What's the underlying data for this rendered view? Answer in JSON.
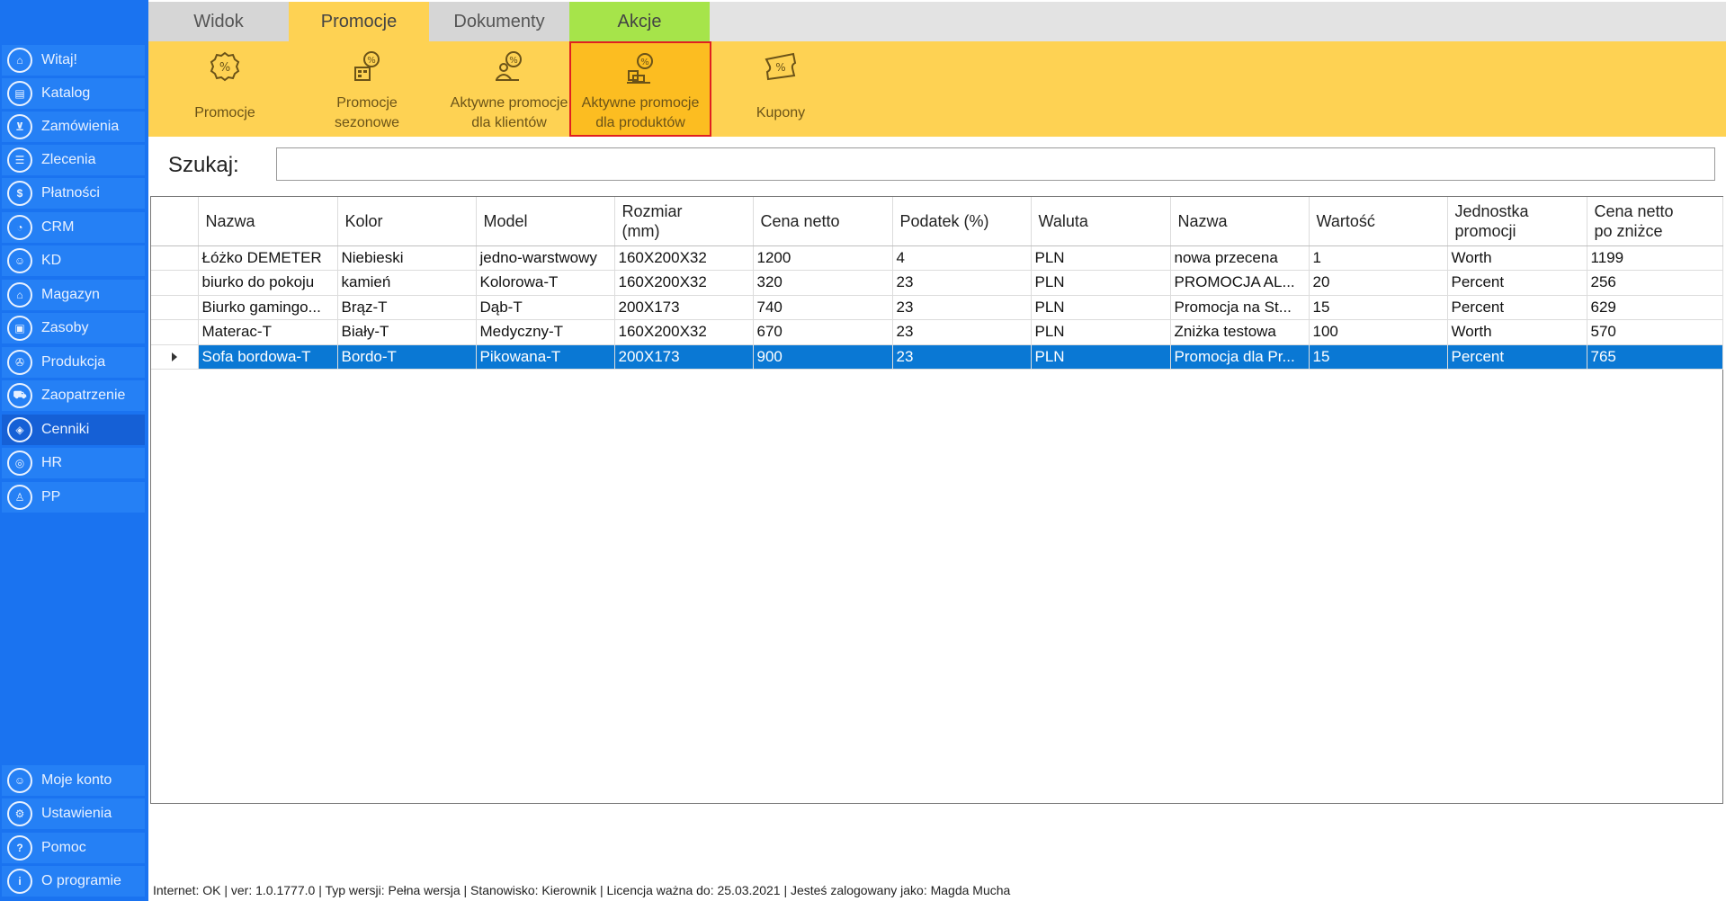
{
  "sidebar": {
    "items": [
      {
        "label": "Witaj!",
        "icon": "home-icon",
        "glyph": "⌂"
      },
      {
        "label": "Katalog",
        "icon": "book-icon",
        "glyph": "▤"
      },
      {
        "label": "Zamówienia",
        "icon": "cart-icon",
        "glyph": "⊻"
      },
      {
        "label": "Zlecenia",
        "icon": "list-icon",
        "glyph": "☰"
      },
      {
        "label": "Płatności",
        "icon": "dollar-icon",
        "glyph": "$"
      },
      {
        "label": "CRM",
        "icon": "crm-icon",
        "glyph": "◔"
      },
      {
        "label": "KD",
        "icon": "person-icon",
        "glyph": "☺"
      },
      {
        "label": "Magazyn",
        "icon": "warehouse-icon",
        "glyph": "⌂"
      },
      {
        "label": "Zasoby",
        "icon": "resources-icon",
        "glyph": "▣"
      },
      {
        "label": "Produkcja",
        "icon": "production-icon",
        "glyph": "✇"
      },
      {
        "label": "Zaopatrzenie",
        "icon": "truck-icon",
        "glyph": "⛟"
      },
      {
        "label": "Cenniki",
        "icon": "tag-icon",
        "glyph": "◈"
      },
      {
        "label": "HR",
        "icon": "hr-icon",
        "glyph": "◎"
      },
      {
        "label": "PP",
        "icon": "pp-icon",
        "glyph": "♙"
      }
    ],
    "bottom_items": [
      {
        "label": "Moje konto",
        "icon": "account-icon",
        "glyph": "☺"
      },
      {
        "label": "Ustawienia",
        "icon": "gear-icon",
        "glyph": "⚙"
      },
      {
        "label": "Pomoc",
        "icon": "help-icon",
        "glyph": "?"
      },
      {
        "label": "O programie",
        "icon": "info-icon",
        "glyph": "i"
      }
    ],
    "active_index": 11
  },
  "tabs": [
    {
      "label": "Widok"
    },
    {
      "label": "Promocje"
    },
    {
      "label": "Dokumenty"
    },
    {
      "label": "Akcje"
    }
  ],
  "ribbon": {
    "buttons": [
      {
        "line1": "Promocje",
        "line2": "",
        "icon": "percent-badge-icon"
      },
      {
        "line1": "Promocje",
        "line2": "sezonowe",
        "icon": "seasonal-promo-icon"
      },
      {
        "line1": "Aktywne promocje",
        "line2": "dla klientów",
        "icon": "client-promo-icon"
      },
      {
        "line1": "Aktywne promocje",
        "line2": "dla produktów",
        "icon": "product-promo-icon"
      },
      {
        "line1": "Kupony",
        "line2": "",
        "icon": "coupon-icon"
      }
    ]
  },
  "search": {
    "label": "Szukaj:",
    "value": ""
  },
  "grid": {
    "headers": [
      [
        "Nazwa"
      ],
      [
        "Kolor"
      ],
      [
        "Model"
      ],
      [
        "Rozmiar",
        "(mm)"
      ],
      [
        "Cena netto"
      ],
      [
        "Podatek (%)"
      ],
      [
        "Waluta"
      ],
      [
        "Nazwa"
      ],
      [
        "Wartość"
      ],
      [
        "Jednostka",
        "promocji"
      ],
      [
        "Cena netto",
        "po zniżce"
      ]
    ],
    "rows": [
      [
        "Łóżko DEMETER",
        "Niebieski",
        "jedno-warstwowy",
        "160X200X32",
        "1200",
        "4",
        "PLN",
        "nowa przecena",
        "1",
        "Worth",
        "1199"
      ],
      [
        "biurko do pokoju",
        "kamień",
        "Kolorowa-T",
        "160X200X32",
        "320",
        "23",
        "PLN",
        "PROMOCJA AL...",
        "20",
        "Percent",
        "256"
      ],
      [
        "Biurko gamingo...",
        "Brąz-T",
        "Dąb-T",
        "200X173",
        "740",
        "23",
        "PLN",
        "Promocja na St...",
        "15",
        "Percent",
        "629"
      ],
      [
        "Materac-T",
        "Biały-T",
        "Medyczny-T",
        "160X200X32",
        "670",
        "23",
        "PLN",
        "Zniżka testowa",
        "100",
        "Worth",
        "570"
      ],
      [
        "Sofa bordowa-T",
        "Bordo-T",
        "Pikowana-T",
        "200X173",
        "900",
        "23",
        "PLN",
        "Promocja dla Pr...",
        "15",
        "Percent",
        "765"
      ]
    ],
    "selected_row": 4
  },
  "statusbar": {
    "text": "Internet: OK  |   ver: 1.0.1777.0   |   Typ wersji: Pełna wersja   |   Stanowisko: Kierownik   |   Licencja ważna do: 25.03.2021   |   Jesteś zalogowany jako: Magda Mucha"
  }
}
